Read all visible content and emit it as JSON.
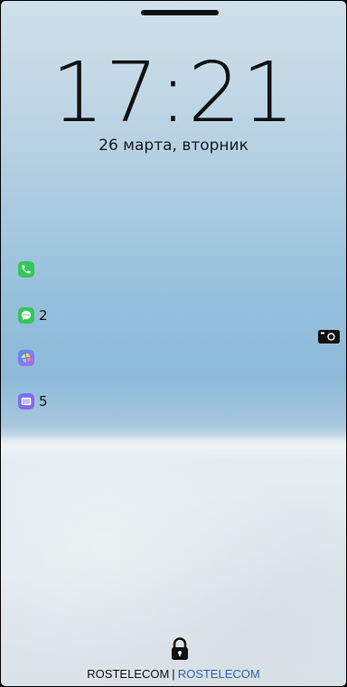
{
  "lockscreen": {
    "time": "17:21",
    "date": "26 марта, вторник"
  },
  "notifications": [
    {
      "app": "phone",
      "icon": "phone-icon",
      "count": "",
      "color": "#34c759"
    },
    {
      "app": "messages",
      "icon": "messages-icon",
      "count": "2",
      "color": "#34c759"
    },
    {
      "app": "gallery",
      "icon": "gallery-icon",
      "count": "",
      "color": "#6b6ee8"
    },
    {
      "app": "notes",
      "icon": "notes-icon",
      "count": "5",
      "color": "#7a5ce6"
    }
  ],
  "carrier": {
    "sim1": "ROSTELECOM",
    "separator": "|",
    "sim2": "ROSTELECOM",
    "sim2_color": "#2a64b0"
  }
}
